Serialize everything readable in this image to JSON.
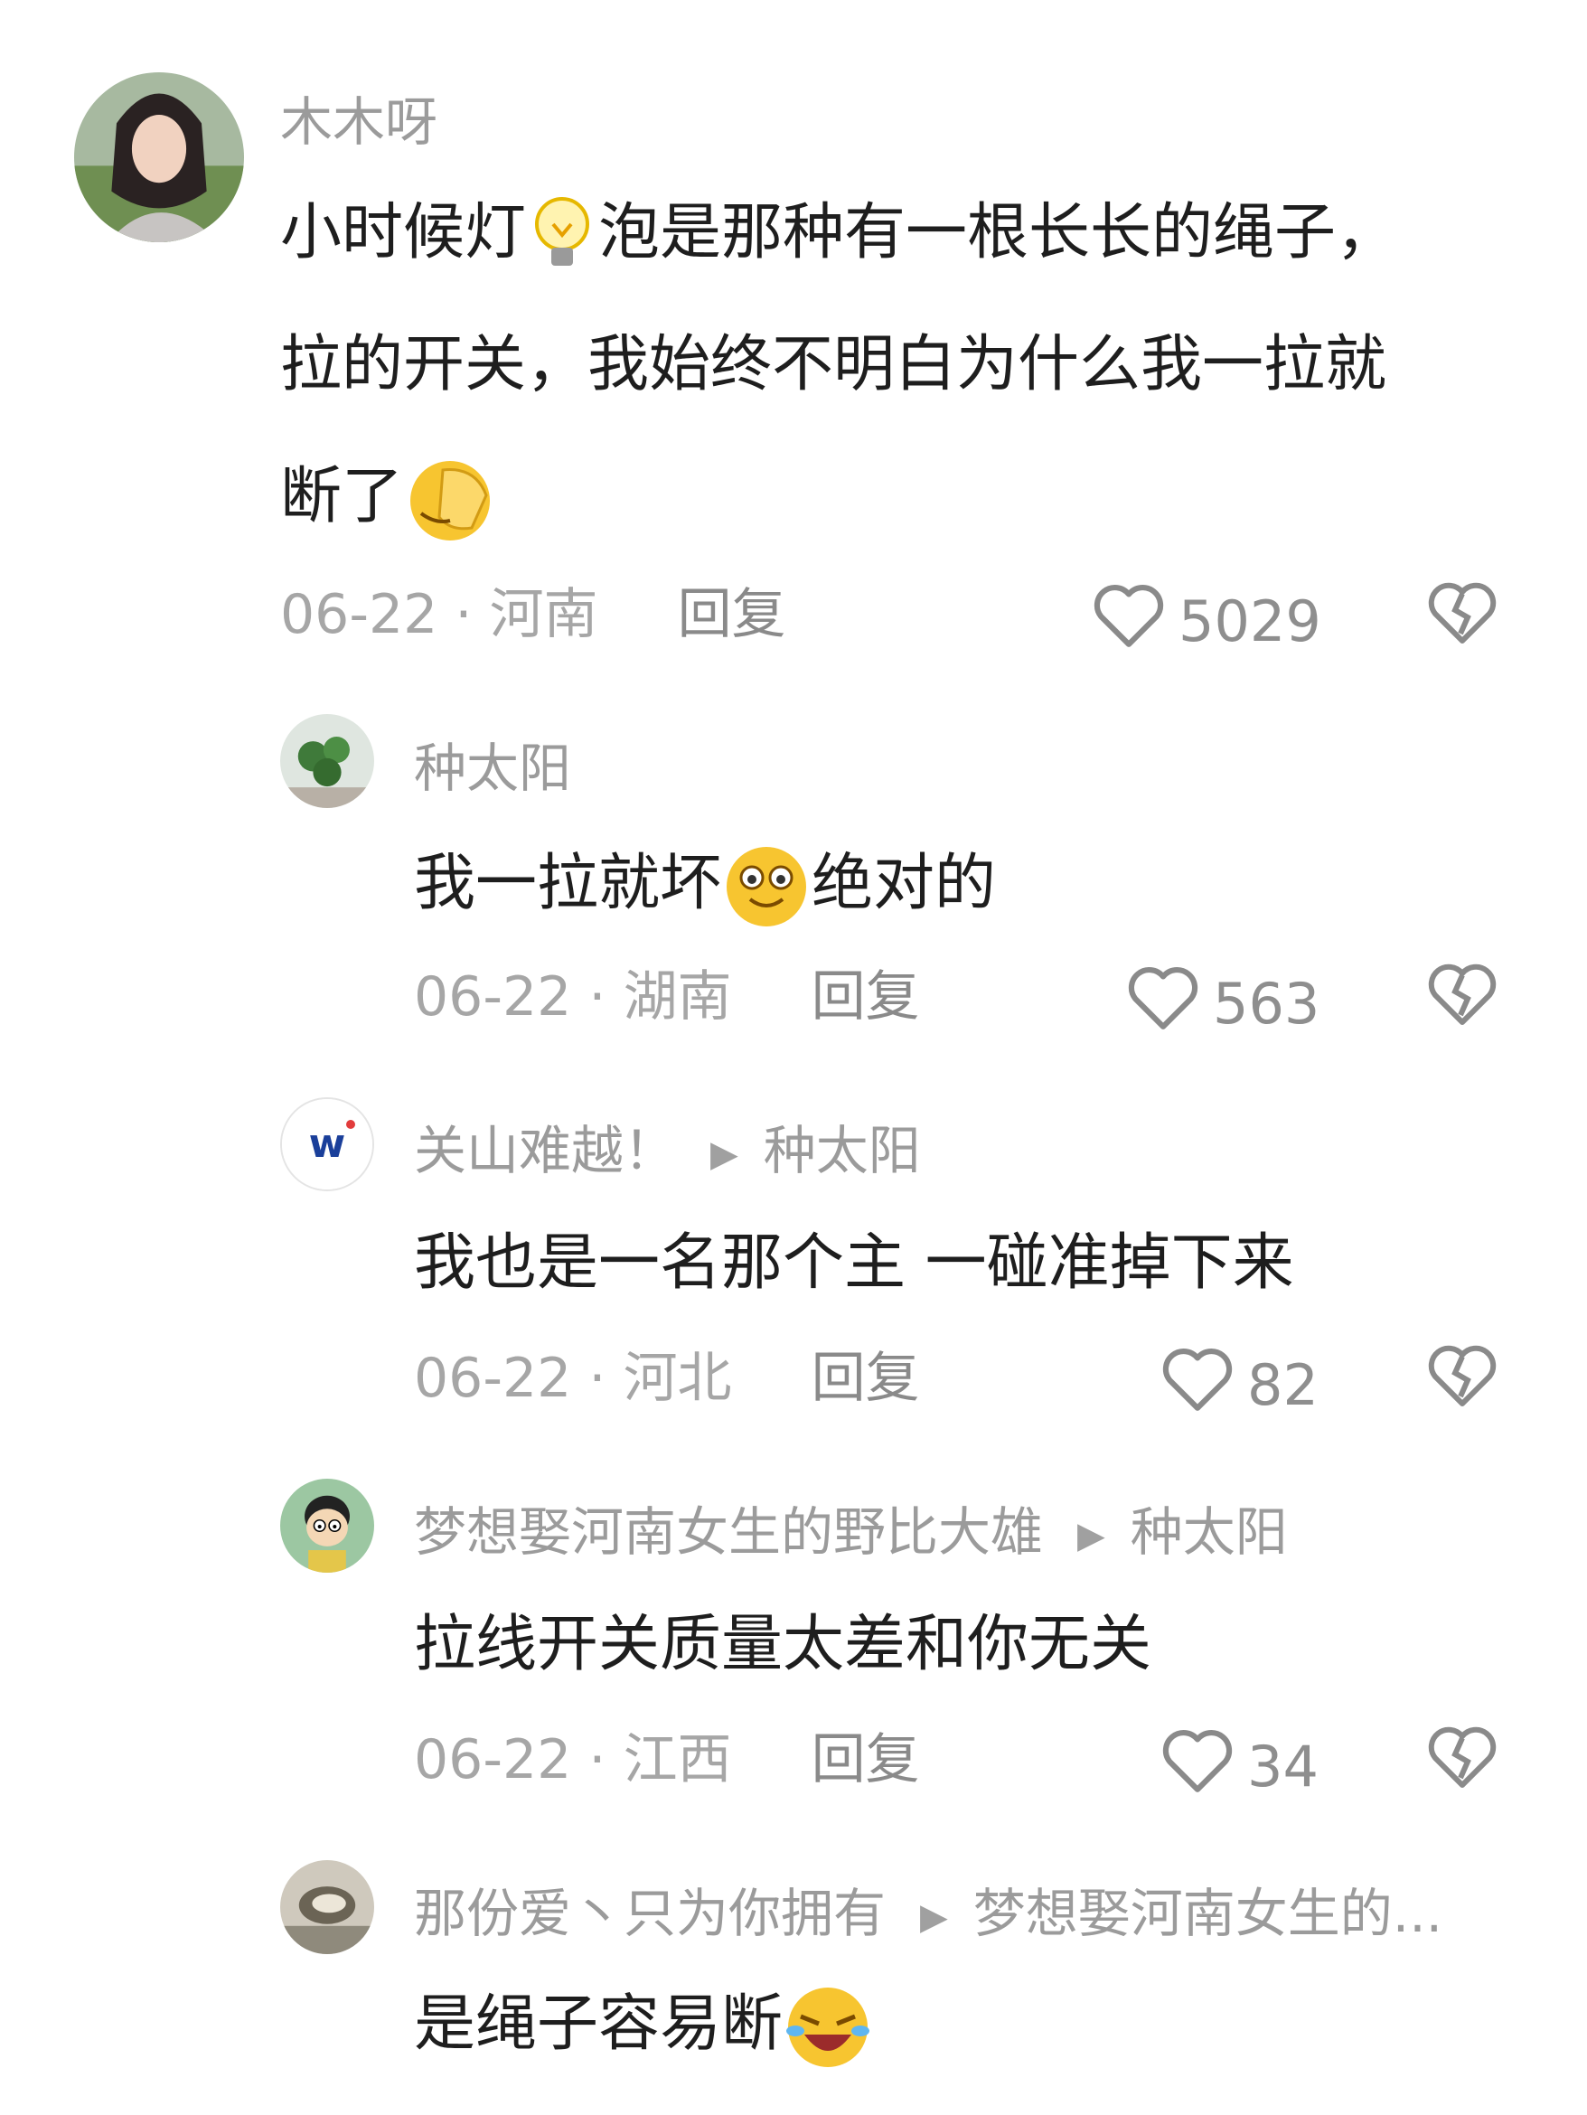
{
  "comments": [
    {
      "user": "木木呀",
      "text_lines": [
        "小时候灯",
        "泡是那种有一根长长的绳子，",
        "拉的开关，我始终不明白为什么我一拉就",
        "断了"
      ],
      "emoji_names": [
        "lightbulb-emoji",
        "facepalm-emoji"
      ],
      "date": "06-22 · 河南",
      "reply": "回复",
      "likes": "5029"
    },
    {
      "user": "种太阳",
      "text_before": "我一拉就坏",
      "text_after": "绝对的",
      "emoji_names": [
        "smiling-face-emoji"
      ],
      "date": "06-22 · 湖南",
      "reply": "回复",
      "likes": "563"
    },
    {
      "user": "关山难越！",
      "reply_to": "种太阳",
      "text": "我也是一名那个主  一碰准掉下来",
      "date": "06-22 · 河北",
      "reply": "回复",
      "likes": "82"
    },
    {
      "user": "梦想娶河南女生的野比大雄",
      "reply_to": "种太阳",
      "text": "拉线开关质量太差和你无关",
      "date": "06-22 · 江西",
      "reply": "回复",
      "likes": "34"
    },
    {
      "user": "那份爱丶只为你拥有",
      "reply_to": "梦想娶河南女生的...",
      "text": "是绳子容易断",
      "emoji_names": [
        "laughing-crying-emoji"
      ],
      "date": "",
      "reply": "",
      "likes": ""
    }
  ],
  "icons": {
    "like": "heart-outline-icon",
    "dislike": "broken-heart-icon",
    "reply_arrow": "play-triangle-icon"
  },
  "colors": {
    "text": "#1e1e1e",
    "meta": "#a6a6a6",
    "name": "#9b9b9b",
    "emoji_yellow": "#f7c530"
  }
}
